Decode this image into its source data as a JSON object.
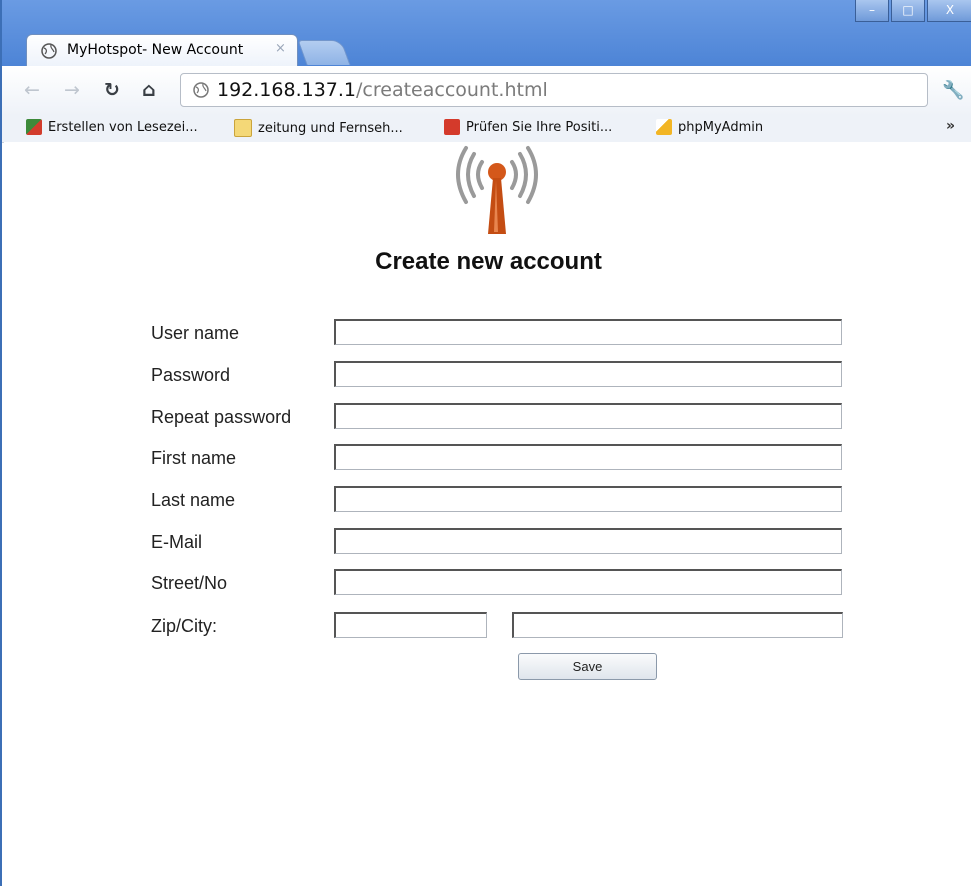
{
  "browser": {
    "tab_title": "MyHotspot- New Account",
    "tab_close": "×",
    "window_buttons": [
      "–",
      "□",
      "X"
    ],
    "url_host": "192.168.137.1",
    "url_path": "/createaccount.html",
    "bookmarks": [
      {
        "label": "Erstellen von Lesezei...",
        "icon": "bookmark-colored-icon",
        "color": "#3d8a3a"
      },
      {
        "label": "zeitung und Fernseh...",
        "icon": "folder-icon",
        "color": "#e8c655"
      },
      {
        "label": "Prüfen Sie Ihre Positi...",
        "icon": "red-chart-icon",
        "color": "#d43a2b"
      },
      {
        "label": "phpMyAdmin",
        "icon": "phpmyadmin-sail-icon",
        "color": "#f2b524"
      }
    ],
    "bookmarks_more": "»"
  },
  "page": {
    "heading": "Create new account",
    "fields": [
      {
        "label": "User name",
        "value": ""
      },
      {
        "label": "Password",
        "value": ""
      },
      {
        "label": "Repeat password",
        "value": ""
      },
      {
        "label": "First name",
        "value": ""
      },
      {
        "label": "Last name",
        "value": ""
      },
      {
        "label": "E-Mail",
        "value": ""
      },
      {
        "label": "Street/No",
        "value": ""
      },
      {
        "label": "Zip/City:",
        "value": ""
      }
    ],
    "save_label": "Save",
    "logo_icon": "wifi-antenna-icon",
    "accent_color": "#d4581a"
  }
}
